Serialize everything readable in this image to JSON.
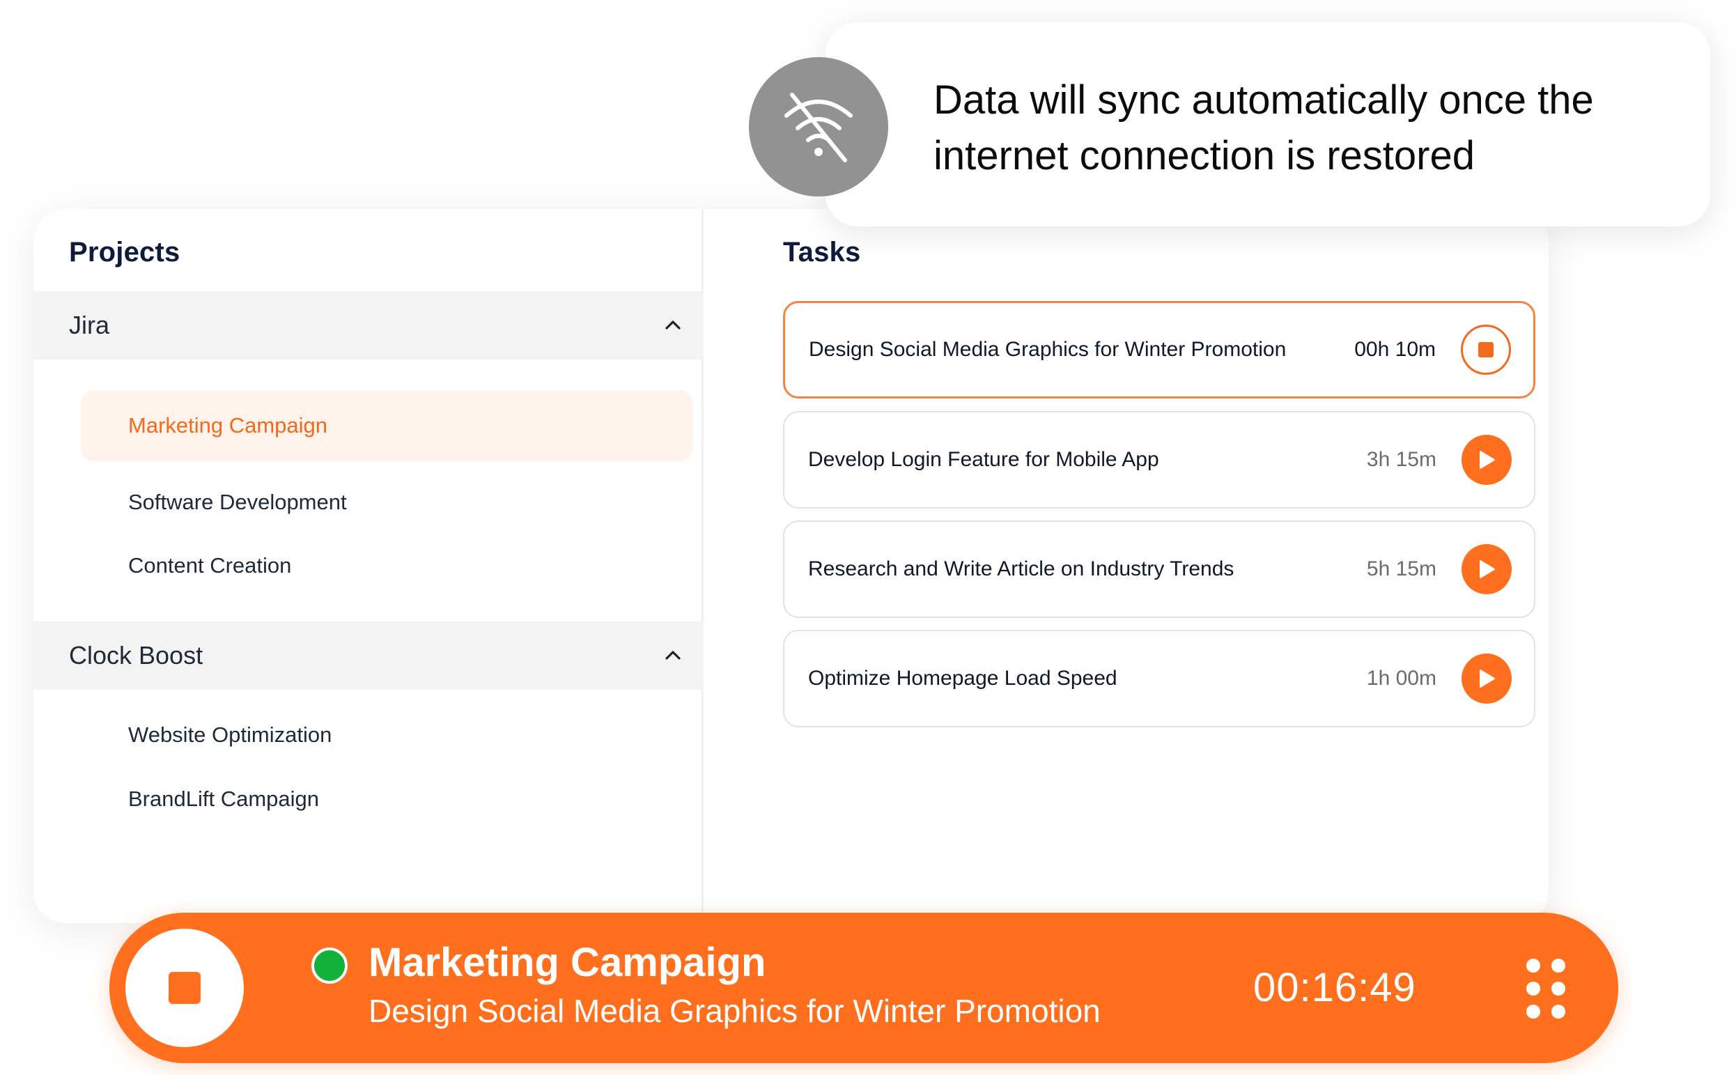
{
  "toast": {
    "message_line1": "Data will sync  automatically once the",
    "message_line2": "internet connection is restored",
    "icon": "wifi-off-icon"
  },
  "projects": {
    "title": "Projects",
    "groups": [
      {
        "name": "Jira",
        "expanded": true,
        "items": [
          "Marketing Campaign",
          "Software Development",
          "Content Creation"
        ]
      },
      {
        "name": "Clock Boost",
        "expanded": true,
        "items": [
          "Website Optimization",
          "BrandLift Campaign"
        ]
      }
    ],
    "selected": "Marketing Campaign"
  },
  "tasks": {
    "title": "Tasks",
    "rows": [
      {
        "name": "Design Social Media Graphics for Winter Promotion",
        "time": "00h 10m",
        "state": "running"
      },
      {
        "name": "Develop Login Feature for Mobile App",
        "time": "3h 15m",
        "state": "idle"
      },
      {
        "name": "Research and Write Article on Industry Trends",
        "time": "5h 15m",
        "state": "idle"
      },
      {
        "name": "Optimize Homepage Load Speed",
        "time": "1h 00m",
        "state": "idle"
      }
    ]
  },
  "timer": {
    "project": "Marketing Campaign",
    "task": "Design Social Media Graphics for Winter Promotion",
    "elapsed": "00:16:49",
    "status_color": "#12b23a"
  },
  "colors": {
    "accent": "#ff6f1e",
    "accent_light": "#fff3ec",
    "online": "#12b23a",
    "offline_icon_bg": "#929292"
  }
}
